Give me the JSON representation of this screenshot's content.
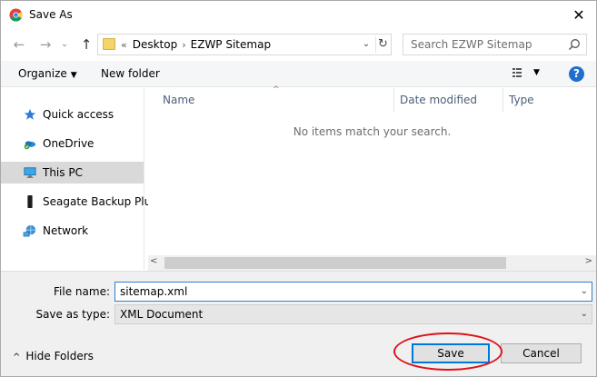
{
  "window": {
    "title": "Save As",
    "close_glyph": "✕"
  },
  "nav": {
    "back_glyph": "←",
    "forward_glyph": "→",
    "recent_glyph": "⌄",
    "up_glyph": "↑",
    "breadcrumb_prefix": "«",
    "breadcrumbs": [
      "Desktop",
      "EZWP Sitemap"
    ],
    "refresh_glyph": "↻",
    "dropdown_glyph": "⌄"
  },
  "search": {
    "placeholder": "Search EZWP Sitemap"
  },
  "toolbar": {
    "organize_label": "Organize",
    "new_folder_label": "New folder",
    "help_label": "?"
  },
  "sidebar": {
    "items": [
      {
        "label": "Quick access",
        "icon": "star-icon",
        "selected": false
      },
      {
        "label": "OneDrive",
        "icon": "onedrive-icon",
        "selected": false
      },
      {
        "label": "This PC",
        "icon": "monitor-icon",
        "selected": true
      },
      {
        "label": "Seagate Backup Plus",
        "icon": "drive-icon",
        "selected": false
      },
      {
        "label": "Network",
        "icon": "network-icon",
        "selected": false
      }
    ]
  },
  "file_list": {
    "columns": [
      "Name",
      "Date modified",
      "Type"
    ],
    "empty_message": "No items match your search."
  },
  "form": {
    "file_name_label": "File name:",
    "file_name_value": "sitemap.xml",
    "save_type_label": "Save as type:",
    "save_type_value": "XML Document"
  },
  "footer": {
    "hide_folders_label": "Hide Folders",
    "save_label": "Save",
    "cancel_label": "Cancel"
  },
  "colors": {
    "accent": "#0078d7",
    "highlight_ring": "#e0111a",
    "selected_bg": "#d9d9d9"
  }
}
